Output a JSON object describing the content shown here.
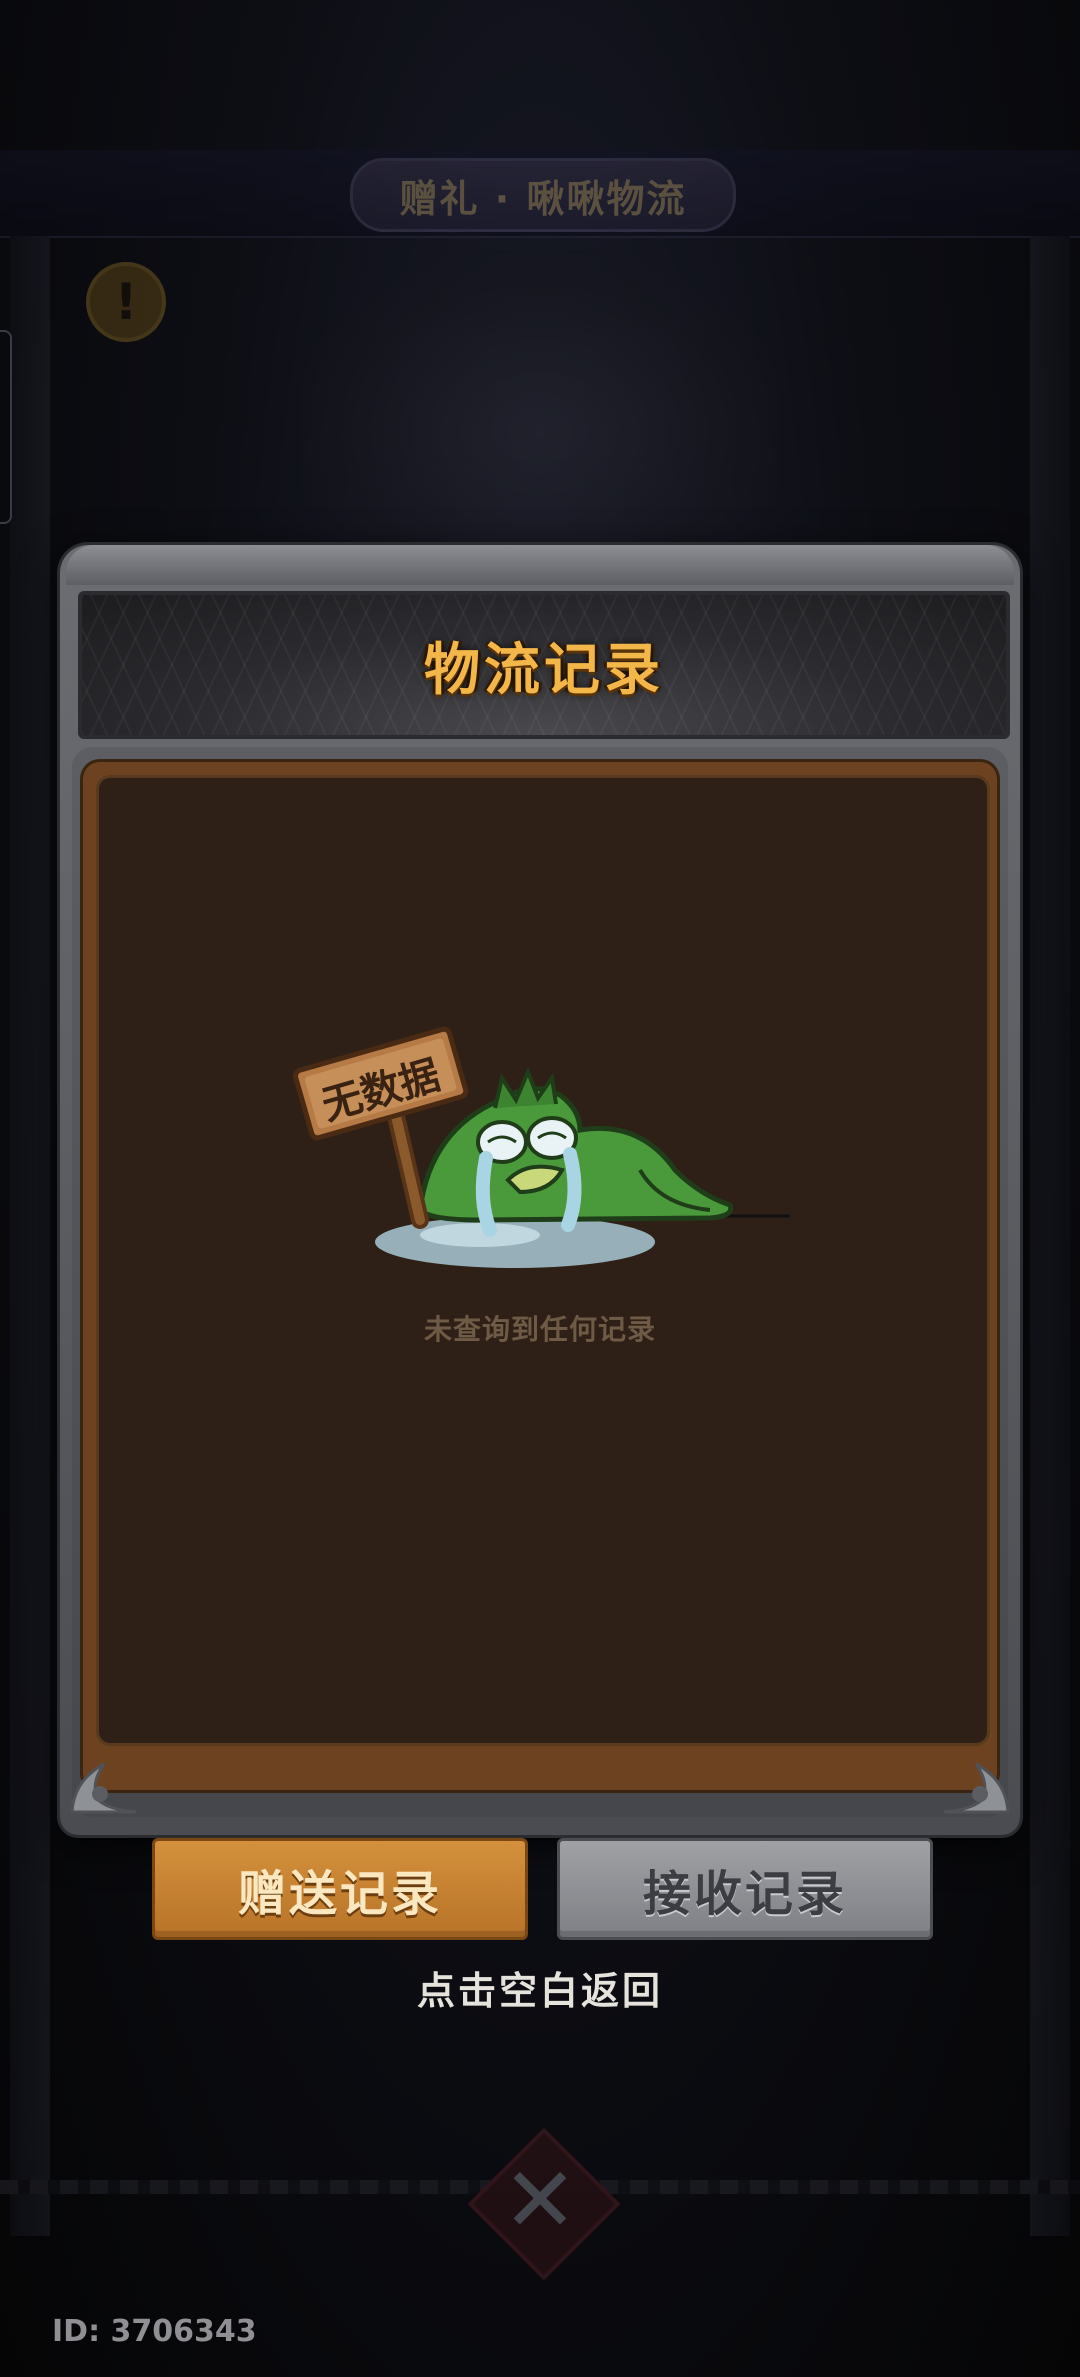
{
  "background": {
    "title": "赠礼 · 啾啾物流"
  },
  "dialog": {
    "title": "物流记录",
    "empty_sign": "无数据",
    "empty_message": "未查询到任何记录"
  },
  "tabs": {
    "send_label": "赠送记录",
    "receive_label": "接收记录",
    "active": "send"
  },
  "hint": "点击空白返回",
  "footer": {
    "player_id": "ID: 3706343"
  },
  "colors": {
    "title_gold": "#f3b648",
    "active_tab": "#d4913c",
    "inactive_tab": "#9fa1a5",
    "panel_brown": "#2e2016",
    "frog_green": "#4a9a3c"
  }
}
